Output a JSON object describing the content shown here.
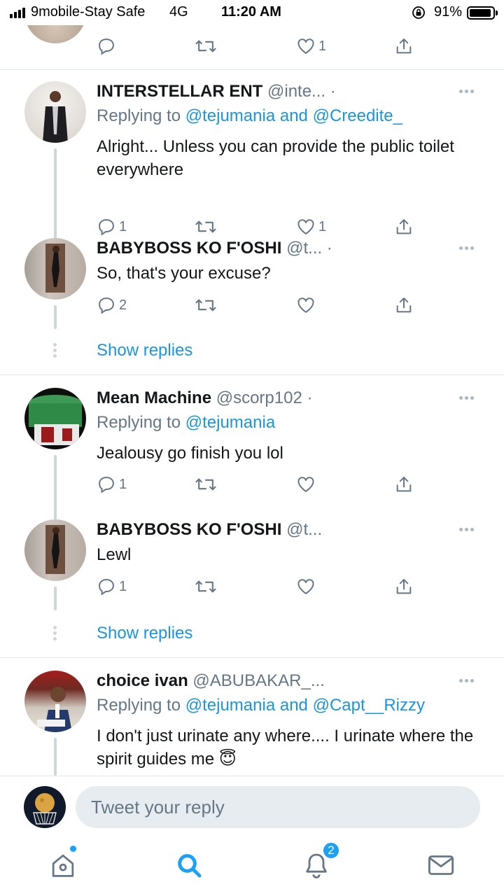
{
  "status_bar": {
    "carrier": "9mobile-Stay Safe",
    "network": "4G",
    "time": "11:20 AM",
    "battery": "91%",
    "battery_level": 0.91
  },
  "top_actions": {
    "like_count": "1"
  },
  "tweets": [
    {
      "name": "INTERSTELLAR ENT",
      "handle": "@inte...",
      "sep": "·",
      "replying_prefix": "Replying to",
      "mentions": [
        "@tejumania",
        "@Creedite_"
      ],
      "and": "and",
      "text": "Alright... Unless you can provide the public toilet everywhere",
      "reply_count": "1",
      "like_count": "1"
    },
    {
      "name": "BABYBOSS KO F'OSHI",
      "handle": "@t...",
      "sep": "·",
      "text": "So, that's your excuse?",
      "reply_count": "2"
    },
    {
      "name": "Mean Machine",
      "handle": "@scorp102",
      "sep": "·",
      "replying_prefix": "Replying to",
      "mentions": [
        "@tejumania"
      ],
      "text": "Jealousy go finish you lol",
      "reply_count": "1"
    },
    {
      "name": "BABYBOSS KO F'OSHI",
      "handle": "@t...",
      "text": "Lewl",
      "reply_count": "1"
    },
    {
      "name": "choice ivan",
      "handle": "@ABUBAKAR_...",
      "replying_prefix": "Replying to",
      "mentions": [
        "@tejumania",
        "@Capt__Rizzy"
      ],
      "and": "and",
      "text": "I don't just urinate any where.... I urinate where the spirit guides me",
      "emoji": "😇"
    }
  ],
  "show_replies": "Show replies",
  "reply_bar": {
    "placeholder": "Tweet your reply"
  },
  "tab_bar": {
    "items": [
      "home-icon",
      "search-icon",
      "notifications-icon",
      "messages-icon"
    ],
    "notifications_badge": "2"
  },
  "colors": {
    "accent": "#1da1f2",
    "link": "#1b95e0",
    "muted": "#657786"
  }
}
